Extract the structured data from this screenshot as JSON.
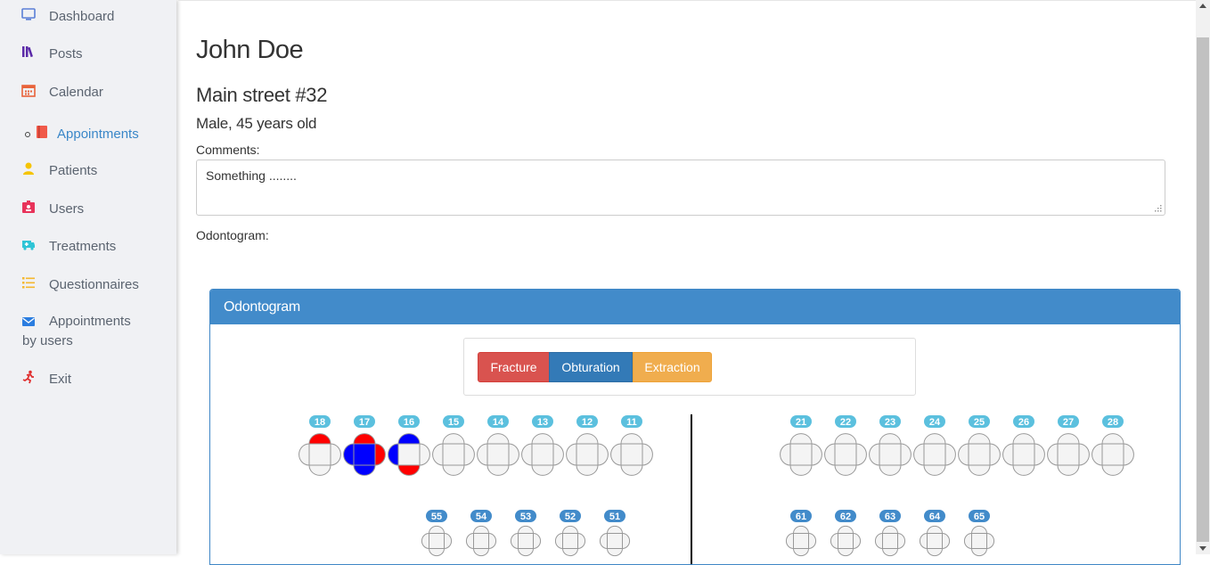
{
  "sidebar": {
    "items": [
      {
        "label": "Dashboard",
        "icon": "monitor-icon",
        "color": "#5b7fd6"
      },
      {
        "label": "Posts",
        "icon": "books-icon",
        "color": "#5b2aa8"
      },
      {
        "label": "Calendar",
        "icon": "calendar-icon",
        "color": "#e8633a"
      },
      {
        "label": "Appointments",
        "icon": "book-icon",
        "color": "#f05a4a",
        "active": true
      },
      {
        "label": "Patients",
        "icon": "user-icon",
        "color": "#f5c400"
      },
      {
        "label": "Users",
        "icon": "id-card-icon",
        "color": "#e8335a"
      },
      {
        "label": "Treatments",
        "icon": "ambulance-icon",
        "color": "#2ec4d6"
      },
      {
        "label": "Questionnaires",
        "icon": "list-icon",
        "color": "#f5b82e"
      },
      {
        "label": "Appointments by users",
        "icon": "envelope-icon",
        "color": "#2b7de0"
      },
      {
        "label": "Exit",
        "icon": "running-icon",
        "color": "#e03030"
      }
    ]
  },
  "patient": {
    "name": "John Doe",
    "address": "Main street #32",
    "info": "Male, 45 years old",
    "comments_label": "Comments:",
    "comments_value": "Something ........",
    "odontogram_label": "Odontogram:"
  },
  "panel": {
    "title": "Odontogram",
    "buttons": {
      "fracture": "Fracture",
      "obturation": "Obturation",
      "extraction": "Extraction"
    },
    "colors": {
      "fracture": "#d9534f",
      "obturation": "#337ab7",
      "extraction": "#f0ad4e",
      "badge_permanent": "#5bc0de",
      "badge_deciduous": "#428bca",
      "mark_red": "#ff0000",
      "mark_blue": "#0000ff"
    }
  },
  "teeth": {
    "upper_right": [
      {
        "num": "18",
        "marks": {
          "top": "red"
        }
      },
      {
        "num": "17",
        "marks": {
          "top": "red",
          "left": "blue",
          "right": "red",
          "center": "blue",
          "bottom": "blue"
        }
      },
      {
        "num": "16",
        "marks": {
          "top": "blue",
          "left": "blue",
          "bottom": "red"
        }
      },
      {
        "num": "15",
        "marks": {}
      },
      {
        "num": "14",
        "marks": {}
      },
      {
        "num": "13",
        "marks": {}
      },
      {
        "num": "12",
        "marks": {}
      },
      {
        "num": "11",
        "marks": {}
      }
    ],
    "upper_left": [
      {
        "num": "21",
        "marks": {}
      },
      {
        "num": "22",
        "marks": {}
      },
      {
        "num": "23",
        "marks": {}
      },
      {
        "num": "24",
        "marks": {}
      },
      {
        "num": "25",
        "marks": {}
      },
      {
        "num": "26",
        "marks": {}
      },
      {
        "num": "27",
        "marks": {}
      },
      {
        "num": "28",
        "marks": {}
      }
    ],
    "deciduous_right": [
      {
        "num": "55"
      },
      {
        "num": "54"
      },
      {
        "num": "53"
      },
      {
        "num": "52"
      },
      {
        "num": "51"
      }
    ],
    "deciduous_left": [
      {
        "num": "61"
      },
      {
        "num": "62"
      },
      {
        "num": "63"
      },
      {
        "num": "64"
      },
      {
        "num": "65"
      }
    ]
  }
}
